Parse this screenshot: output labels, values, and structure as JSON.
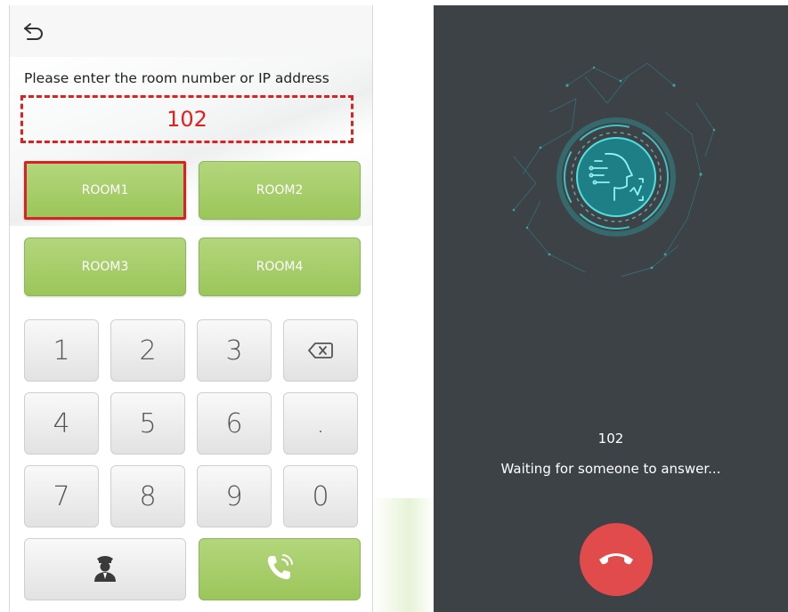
{
  "dialer": {
    "back_icon": "back-arrow-icon",
    "prompt": "Please enter the room number or IP address",
    "entry_value": "102",
    "rooms": [
      {
        "label": "ROOM1",
        "selected": true
      },
      {
        "label": "ROOM2",
        "selected": false
      },
      {
        "label": "ROOM3",
        "selected": false
      },
      {
        "label": "ROOM4",
        "selected": false
      }
    ],
    "keys": {
      "k1": "1",
      "k2": "2",
      "k3": "3",
      "k4": "4",
      "k5": "5",
      "k6": "6",
      "kdot": ".",
      "k7": "7",
      "k8": "8",
      "k9": "9",
      "k0": "0"
    },
    "backspace_icon": "backspace-icon",
    "guard_icon": "security-guard-icon",
    "call_icon": "phone-call-icon"
  },
  "calling": {
    "callee": "102",
    "status": "Waiting for someone to answer...",
    "hangup_icon": "hang-up-phone-icon",
    "graphic_icon": "ai-face-scan-icon"
  },
  "colors": {
    "accent_red": "#e01f1f",
    "room_green": "#a6cc68",
    "call_bg": "#3d4247",
    "hangup_red": "#e24b4b",
    "teal": "#2ec9c9"
  }
}
